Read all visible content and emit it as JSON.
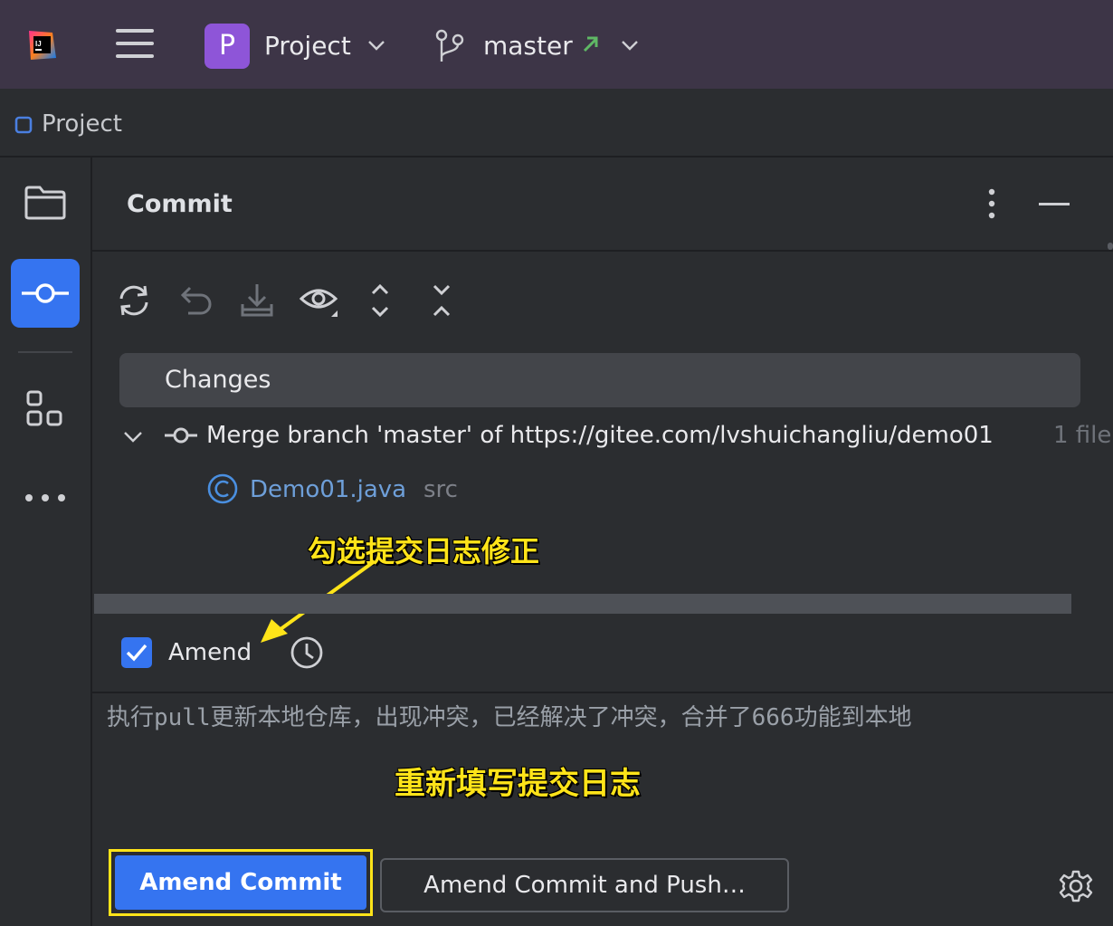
{
  "titlebar": {
    "project_badge": "P",
    "project_name": "Project",
    "branch_name": "master"
  },
  "project_strip": {
    "label": "Project"
  },
  "rail": {
    "items": [
      "project-folder",
      "commit",
      "structure",
      "more"
    ]
  },
  "panel": {
    "title": "Commit",
    "toolbar": [
      "refresh-icon",
      "rollback-icon",
      "update-icon",
      "preview-icon",
      "expand-all-icon",
      "collapse-all-icon"
    ],
    "changes_label": "Changes",
    "merge_commit": "Merge branch 'master' of https://gitee.com/lvshuichangliu/demo01",
    "file_count": "1 file",
    "file": {
      "name": "Demo01.java",
      "dir": "src"
    },
    "amend_label": "Amend",
    "amend_checked": true,
    "commit_message": "执行pull更新本地仓库，出现冲突，已经解决了冲突，合并了666功能到本地",
    "buttons": {
      "primary": "Amend Commit",
      "secondary": "Amend Commit and Push…"
    }
  },
  "annotations": {
    "amend_note": "勾选提交日志修正",
    "message_note": "重新填写提交日志"
  },
  "colors": {
    "accent": "#3574f0",
    "titlebar": "#3d3547",
    "badge": "#8e55d8",
    "annotation": "#ffe419",
    "branch_arrow": "#5fb865",
    "file_link": "#6e9fd9"
  }
}
